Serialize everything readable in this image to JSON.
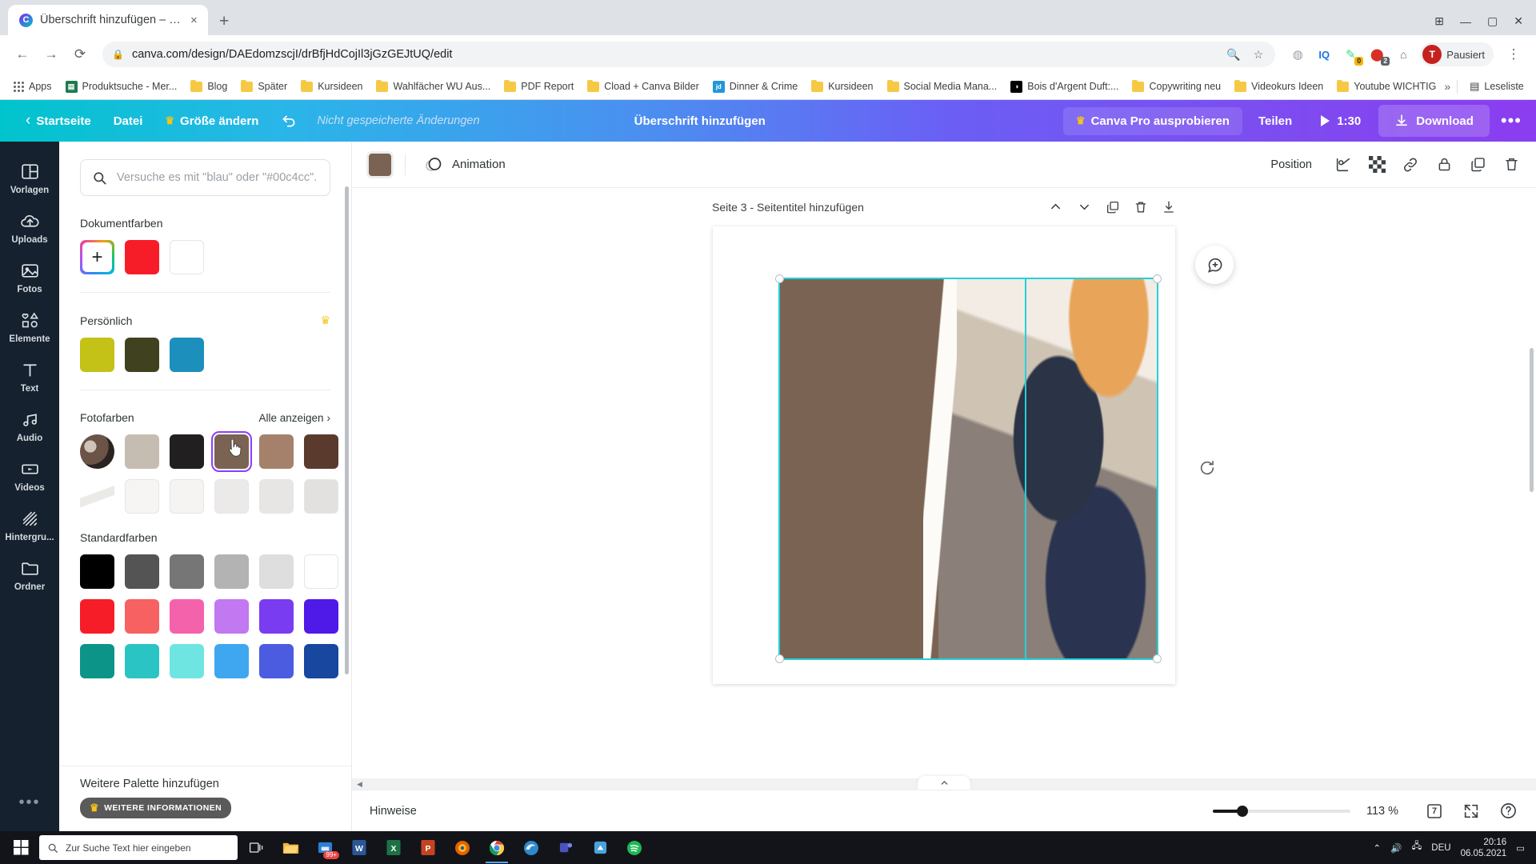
{
  "browser": {
    "tab": {
      "title": "Überschrift hinzufügen – Logo",
      "favicon": "canva-logo-icon",
      "close": "×"
    },
    "new_tab_label": "+",
    "window_controls": {
      "minimize": "—",
      "maximize": "▢",
      "close": "✕",
      "extension": "⊞"
    },
    "omnibox": {
      "back": "←",
      "forward": "→",
      "reload": "⟳",
      "lock_icon": "lock-icon",
      "url": "canva.com/design/DAEdomzscjI/drBfjHdCojIl3jGzGEJtUQ/edit",
      "zoom_icon": "🔍",
      "star_icon": "☆",
      "profile_label": "Pausiert",
      "profile_initial": "T",
      "menu": "⋮"
    },
    "extensions": [
      {
        "name": "ghost-extension-icon",
        "badge": ""
      },
      {
        "name": "iq-extension-icon",
        "badge": ""
      },
      {
        "name": "grammar-extension-icon",
        "badge": "0"
      },
      {
        "name": "adblock-extension-icon",
        "badge": "2"
      },
      {
        "name": "home-extension-icon",
        "badge": ""
      }
    ],
    "bookmarks": [
      {
        "label": "Apps",
        "icon": "apps-grid-icon"
      },
      {
        "label": "Produktsuche - Mer...",
        "icon": "site-icon",
        "color": "#1f7a4d"
      },
      {
        "label": "Blog",
        "icon": "folder-icon"
      },
      {
        "label": "Später",
        "icon": "folder-icon"
      },
      {
        "label": "Kursideen",
        "icon": "folder-icon"
      },
      {
        "label": "Wahlfächer WU Aus...",
        "icon": "folder-icon"
      },
      {
        "label": "PDF Report",
        "icon": "folder-icon"
      },
      {
        "label": "Cload + Canva Bilder",
        "icon": "folder-icon"
      },
      {
        "label": "Dinner & Crime",
        "icon": "jd-site-icon",
        "color": "#2196d9",
        "letters": "jd"
      },
      {
        "label": "Kursideen",
        "icon": "folder-icon"
      },
      {
        "label": "Social Media Mana...",
        "icon": "folder-icon"
      },
      {
        "label": "Bois d'Argent Duft:...",
        "icon": "dior-site-icon",
        "color": "#000000",
        "letters": "◑"
      },
      {
        "label": "Copywriting neu",
        "icon": "folder-icon"
      },
      {
        "label": "Videokurs Ideen",
        "icon": "folder-icon"
      },
      {
        "label": "Youtube WICHTIG",
        "icon": "folder-icon"
      }
    ],
    "bookmarks_overflow": "»",
    "reading_list": "Leseliste"
  },
  "canva_top": {
    "back_icon": "chevron-left-icon",
    "home": "Startseite",
    "file": "Datei",
    "resize": "Größe ändern",
    "undo_icon": "undo-icon",
    "unsaved": "Nicht gespeicherte Änderungen",
    "doc_title": "Überschrift hinzufügen",
    "pro": "Canva Pro ausprobieren",
    "share": "Teilen",
    "present_time": "1:30",
    "download": "Download",
    "more": "•••"
  },
  "rail": {
    "items": [
      {
        "label": "Vorlagen",
        "icon": "templates-icon"
      },
      {
        "label": "Uploads",
        "icon": "upload-cloud-icon"
      },
      {
        "label": "Fotos",
        "icon": "photo-icon"
      },
      {
        "label": "Elemente",
        "icon": "shapes-icon"
      },
      {
        "label": "Text",
        "icon": "text-icon"
      },
      {
        "label": "Audio",
        "icon": "music-note-icon"
      },
      {
        "label": "Videos",
        "icon": "video-icon"
      },
      {
        "label": "Hintergru...",
        "icon": "background-icon"
      },
      {
        "label": "Ordner",
        "icon": "folder-icon"
      }
    ],
    "more": "•••"
  },
  "panel": {
    "search_placeholder": "Versuche es mit \"blau\" oder \"#00c4cc\".",
    "search_value": "",
    "search_icon": "search-icon",
    "sections": [
      {
        "title": "Dokumentfarben",
        "swatches": [
          {
            "name": "add-color",
            "color": "#ffffff",
            "add": true
          },
          {
            "name": "red",
            "color": "#f71d28"
          },
          {
            "name": "white",
            "color": "#ffffff",
            "border": true
          }
        ]
      },
      {
        "title": "Persönlich",
        "pro": true,
        "swatches": [
          {
            "name": "olive-yellow",
            "color": "#c4c117"
          },
          {
            "name": "dark-olive",
            "color": "#40421f"
          },
          {
            "name": "teal-blue",
            "color": "#1d8fbd"
          }
        ]
      }
    ],
    "photo_colors": {
      "title": "Fotofarben",
      "show_all": "Alle anzeigen",
      "show_all_icon": "chevron-right-icon",
      "row1": [
        {
          "name": "photo-thumbnail",
          "color": "#6b5347",
          "photo": true
        },
        {
          "name": "beige",
          "color": "#c6bdb2"
        },
        {
          "name": "near-black",
          "color": "#221f20"
        },
        {
          "name": "brown-selected",
          "color": "#7a6352",
          "selected": true
        },
        {
          "name": "tan",
          "color": "#a5816c"
        },
        {
          "name": "dark-brown",
          "color": "#5b3a2e"
        }
      ],
      "row2": [
        {
          "name": "photo-thumbnail-2",
          "color": "#ffffff",
          "photo": true
        },
        {
          "name": "off-white-1",
          "color": "#f6f5f3",
          "border": true
        },
        {
          "name": "off-white-2",
          "color": "#f5f4f2",
          "border": true
        },
        {
          "name": "light-gray-1",
          "color": "#eceae8",
          "border": true
        },
        {
          "name": "light-gray-2",
          "color": "#e8e6e4",
          "border": true
        },
        {
          "name": "light-gray-3",
          "color": "#e3e1df",
          "border": true
        }
      ]
    },
    "standard_colors": {
      "title": "Standardfarben",
      "row1": [
        "#000000",
        "#545454",
        "#767676",
        "#b3b3b3",
        "#dedede",
        "#ffffff"
      ],
      "row2": [
        "#f71d28",
        "#f76161",
        "#f562ac",
        "#c178f0",
        "#7a3cf0",
        "#4f19e8"
      ],
      "row3": [
        "#0d9488",
        "#2bc4c4",
        "#6fe5e2",
        "#3fa7f0",
        "#4c5ce0",
        "#17479e"
      ]
    },
    "footer": {
      "title": "Weitere Palette hinzufügen",
      "pill": "WEITERE INFORMATIONEN",
      "crown_icon": "crown-icon"
    }
  },
  "editor_toolbar": {
    "color_swatch": "#7a6352",
    "animation": "Animation",
    "animation_icon": "animation-circles-icon",
    "position": "Position",
    "icons": [
      {
        "name": "crop-icon"
      },
      {
        "name": "transparency-icon"
      },
      {
        "name": "link-icon"
      },
      {
        "name": "lock-icon"
      },
      {
        "name": "duplicate-icon"
      },
      {
        "name": "trash-icon"
      }
    ]
  },
  "canvas": {
    "page_label": "Seite 3 - Seitentitel hinzufügen",
    "page_tools": [
      {
        "name": "move-up-icon",
        "glyph": "⌃"
      },
      {
        "name": "move-down-icon",
        "glyph": "⌄"
      },
      {
        "name": "duplicate-page-icon",
        "glyph": "⧉"
      },
      {
        "name": "delete-page-icon",
        "glyph": "🗑"
      },
      {
        "name": "add-page-icon",
        "glyph": "⊞"
      }
    ],
    "comment_icon": "add-comment-icon",
    "rotate_icon": "rotate-handle-icon",
    "expand_icon": "chevron-up-icon"
  },
  "statusbar": {
    "notes": "Hinweise",
    "zoom": "113 %",
    "page_count": "7",
    "fullscreen_icon": "expand-icon",
    "help_icon": "help-icon",
    "grid_icon": "pages-grid-icon"
  },
  "taskbar": {
    "start_icon": "windows-start-icon",
    "search_placeholder": "Zur Suche Text hier eingeben",
    "search_icon": "search-icon",
    "items": [
      {
        "name": "task-view-icon"
      },
      {
        "name": "file-explorer-icon"
      },
      {
        "name": "store-icon",
        "badge": "99+"
      },
      {
        "name": "word-icon"
      },
      {
        "name": "excel-icon"
      },
      {
        "name": "powerpoint-icon"
      },
      {
        "name": "firefox-icon"
      },
      {
        "name": "chrome-icon",
        "active": true
      },
      {
        "name": "edge-icon"
      },
      {
        "name": "teams-icon"
      },
      {
        "name": "unknown-app-icon"
      },
      {
        "name": "spotify-icon"
      }
    ],
    "tray": {
      "expand": "⌃",
      "volume_icon": "volume-icon",
      "network_icon": "network-icon",
      "language": "DEU",
      "time": "20:16",
      "date": "06.05.2021",
      "notification_icon": "notification-icon"
    }
  },
  "colors": {
    "canva_gradient_start": "#00c4cc",
    "canva_gradient_end": "#8b3df0",
    "selection_cyan": "#25d0d8",
    "selected_swatch_outline": "#8b3dff",
    "rail_bg": "#15212e"
  }
}
